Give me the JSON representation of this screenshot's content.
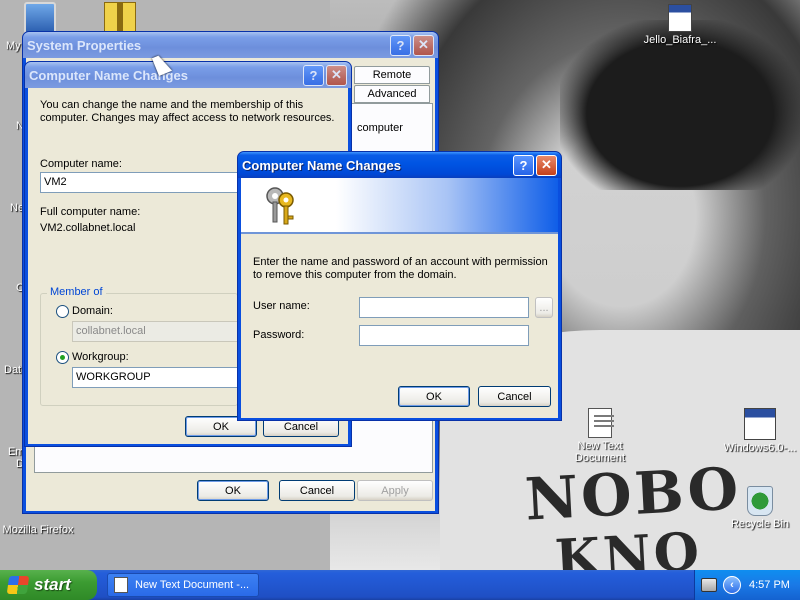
{
  "desktop": {
    "icons": [
      {
        "label": "Jello_Biafra_...",
        "icon": "application-icon"
      },
      {
        "label": "New Text Document",
        "icon": "text-document-icon"
      },
      {
        "label": "Windows6.0-...",
        "icon": "application-icon"
      },
      {
        "label": "Recycle Bin",
        "icon": "recycle-bin-icon"
      },
      {
        "label": "Mozilla Firefox",
        "icon": "firefox-icon"
      }
    ],
    "edge_labels": [
      "My",
      "N",
      "C",
      "Dat",
      "Em",
      "D",
      "Ne"
    ],
    "wallpaper_text": [
      "NOBO",
      "KNO"
    ]
  },
  "system_properties": {
    "title": "System Properties",
    "tabs": [
      "Remote",
      "Advanced"
    ],
    "partial_text": "computer",
    "buttons": {
      "ok": "OK",
      "cancel": "Cancel",
      "apply": "Apply"
    }
  },
  "computer_name_changes_back": {
    "title": "Computer Name Changes",
    "intro": "You can change the name and the membership of this computer. Changes may affect access to network resources.",
    "computer_name_label": "Computer name:",
    "computer_name_value": "VM2",
    "full_name_label": "Full computer name:",
    "full_name_value": "VM2.collabnet.local",
    "member_of_label": "Member of",
    "domain_label": "Domain:",
    "domain_value": "collabnet.local",
    "workgroup_label": "Workgroup:",
    "workgroup_value": "WORKGROUP",
    "selected_membership": "workgroup",
    "buttons": {
      "ok": "OK",
      "cancel": "Cancel"
    }
  },
  "computer_name_changes_front": {
    "title": "Computer Name Changes",
    "message": "Enter the name and password of an account with permission to remove this computer from the domain.",
    "username_label": "User name:",
    "username_value": "",
    "password_label": "Password:",
    "password_value": "",
    "browse_label": "...",
    "buttons": {
      "ok": "OK",
      "cancel": "Cancel"
    }
  },
  "titlebar_buttons": {
    "help": "?",
    "close": "✕"
  },
  "taskbar": {
    "start_label": "start",
    "task_item": "New Text Document -...",
    "tray_chevron": "‹",
    "clock": "4:57 PM"
  }
}
